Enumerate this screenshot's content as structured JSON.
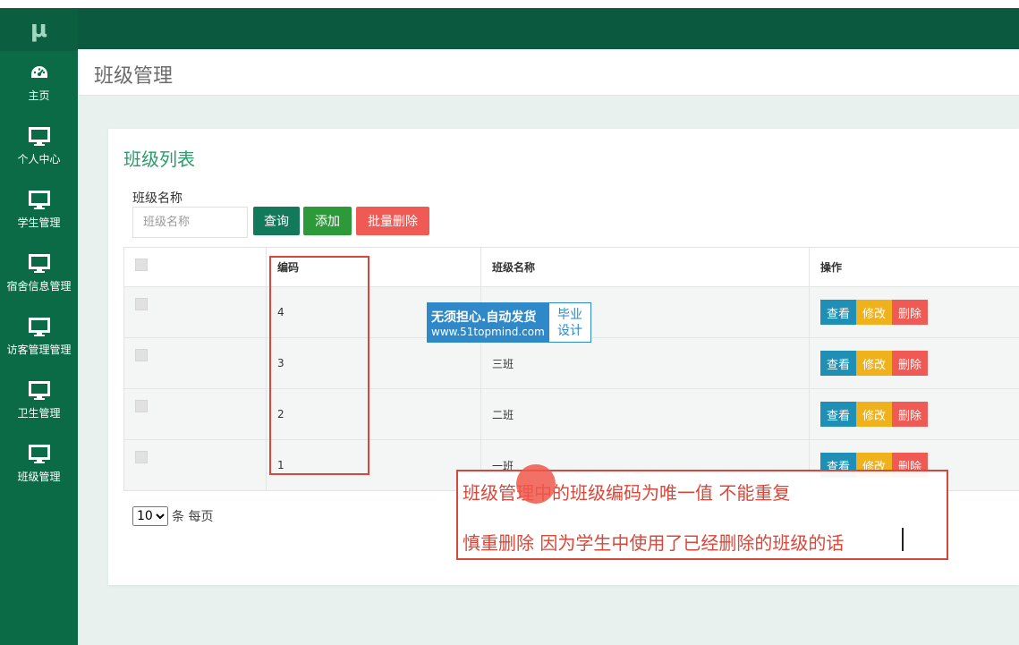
{
  "app": {
    "logo": "μ"
  },
  "sidebar": {
    "items": [
      {
        "label": "主页",
        "icon": "dashboard-icon"
      },
      {
        "label": "个人中心",
        "icon": "monitor-icon"
      },
      {
        "label": "学生管理",
        "icon": "monitor-icon"
      },
      {
        "label": "宿舍信息管理",
        "icon": "monitor-icon"
      },
      {
        "label": "访客管理管理",
        "icon": "monitor-icon"
      },
      {
        "label": "卫生管理",
        "icon": "monitor-icon"
      },
      {
        "label": "班级管理",
        "icon": "monitor-icon"
      }
    ]
  },
  "header": {
    "title": "班级管理"
  },
  "card": {
    "title": "班级列表",
    "filter": {
      "label": "班级名称",
      "placeholder": "班级名称",
      "value": ""
    },
    "buttons": {
      "query": "查询",
      "add": "添加",
      "bulk_delete": "批量删除"
    }
  },
  "table": {
    "columns": [
      "",
      "编码",
      "班级名称",
      "操作"
    ],
    "rows": [
      {
        "code": "4",
        "name": ""
      },
      {
        "code": "3",
        "name": "三班"
      },
      {
        "code": "2",
        "name": "二班"
      },
      {
        "code": "1",
        "name": "一班"
      }
    ],
    "actions": {
      "view": "查看",
      "edit": "修改",
      "delete": "删除"
    }
  },
  "pager": {
    "page_size": "10",
    "options": [
      "10"
    ],
    "suffix": "条 每页"
  },
  "watermark": {
    "line1": "无须担心.自动发货",
    "line2": "www.51topmind.com",
    "right_line1": "毕业",
    "right_line2": "设计"
  },
  "note": {
    "line1": "班级管理中的班级编码为唯一值 不能重复",
    "line2": "慎重删除 因为学生中使用了已经删除的班级的话"
  },
  "colors": {
    "sidebar": "#0c6b47",
    "topbar": "#0b5a3f",
    "accent_green": "#2a9c6b",
    "view": "#1f8fb5",
    "edit": "#f0b21c",
    "delete": "#ef5a55",
    "annotation_red": "#d9473a"
  }
}
